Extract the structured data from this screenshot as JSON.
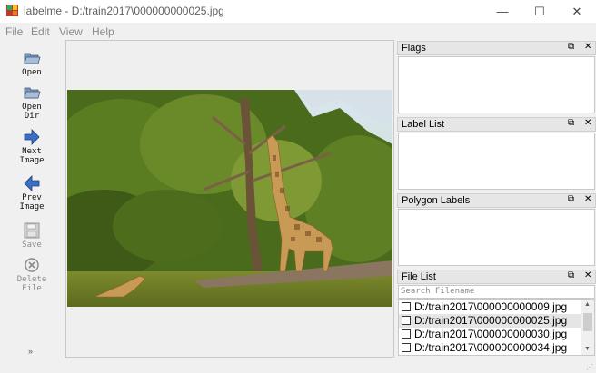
{
  "window": {
    "title": "labelme - D:/train2017\\000000000025.jpg",
    "icon": "labelme-app-icon",
    "minimize_glyph": "—",
    "maximize_glyph": "☐",
    "close_glyph": "✕"
  },
  "menu": [
    "File",
    "Edit",
    "View",
    "Help"
  ],
  "toolbar": {
    "items": [
      {
        "label": "Open",
        "icon": "folder-open-icon",
        "enabled": true
      },
      {
        "label": "Open\nDir",
        "icon": "folder-dir-icon",
        "enabled": true
      },
      {
        "label": "Next\nImage",
        "icon": "arrow-right-icon",
        "enabled": true
      },
      {
        "label": "Prev\nImage",
        "icon": "arrow-left-icon",
        "enabled": true
      },
      {
        "label": "Save",
        "icon": "floppy-save-icon",
        "enabled": false
      },
      {
        "label": "Delete\nFile",
        "icon": "delete-circle-icon",
        "enabled": false
      }
    ],
    "more_glyph": "»"
  },
  "docks": {
    "flags": {
      "title": "Flags"
    },
    "label_list": {
      "title": "Label List"
    },
    "polygon_labels": {
      "title": "Polygon Labels"
    },
    "file_list": {
      "title": "File List",
      "search_placeholder": "Search Filename",
      "files": [
        {
          "name": "D:/train2017\\000000000009.jpg",
          "checked": false,
          "selected": false
        },
        {
          "name": "D:/train2017\\000000000025.jpg",
          "checked": false,
          "selected": true
        },
        {
          "name": "D:/train2017\\000000000030.jpg",
          "checked": false,
          "selected": false
        },
        {
          "name": "D:/train2017\\000000000034.jpg",
          "checked": false,
          "selected": false
        }
      ]
    },
    "float_glyph": "⧉",
    "close_glyph": "✕"
  },
  "colors": {
    "background": "#f0f0f0",
    "selected_row": "#e5e5e5",
    "disabled_text": "#8d8d8d",
    "arrow_blue": "#3a6fc4"
  }
}
